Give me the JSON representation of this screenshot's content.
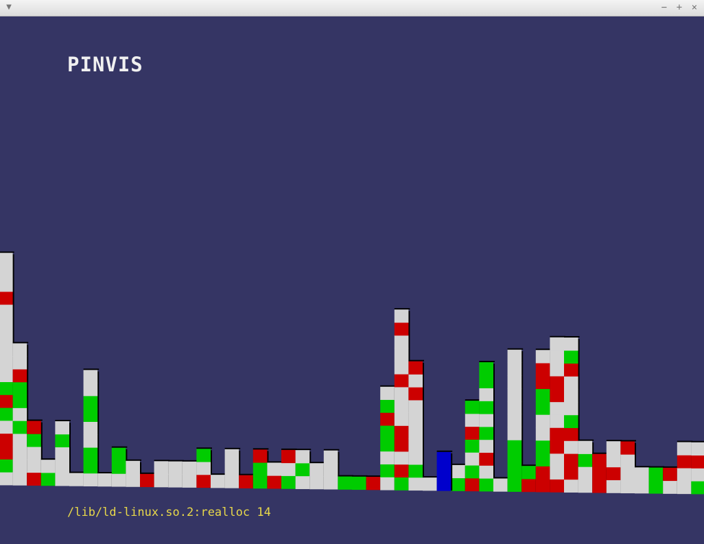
{
  "window": {
    "menu_icon": "chevron-down-icon",
    "controls": [
      {
        "name": "minimize",
        "glyph": "−"
      },
      {
        "name": "maximize",
        "glyph": "+"
      },
      {
        "name": "close",
        "glyph": "×"
      }
    ]
  },
  "app": {
    "title": "PINVIS",
    "status": "/lib/ld-linux.so.2:realloc 14"
  },
  "colors": {
    "background": "#353564",
    "gray": "#d4d4d4",
    "green": "#00cc00",
    "red": "#cc0000",
    "selected": "#0000cc",
    "title_text": "#f0f0f0",
    "status_text": "#e8d84a"
  },
  "chart_data": {
    "type": "bar",
    "x_label": "",
    "y_label": "",
    "bar_heights": [
      18,
      11,
      5,
      2,
      5,
      1,
      9,
      1,
      3,
      2,
      1,
      2,
      2,
      2,
      3,
      1,
      3,
      1,
      3,
      2,
      3,
      3,
      2,
      3,
      1,
      1,
      1,
      8,
      14,
      10,
      1,
      3,
      2,
      7,
      10,
      1,
      11,
      2,
      11,
      12,
      12,
      4,
      3,
      4,
      4,
      2,
      2,
      2,
      4,
      4
    ],
    "selected_bar": 31,
    "legend": []
  }
}
